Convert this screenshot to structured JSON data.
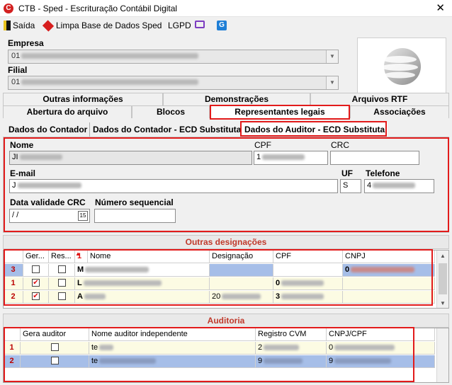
{
  "window": {
    "title": "CTB - Sped - Escrituração Contábil Digital",
    "close": "✕"
  },
  "menu": {
    "exit": "Saída",
    "clear_db": "Limpa Base de Dados Sped",
    "lgpd": "LGPD"
  },
  "header": {
    "empresa_label": "Empresa",
    "empresa_value": "01",
    "filial_label": "Filial",
    "filial_value": "01"
  },
  "tabs_row1": [
    "Outras informações",
    "Demonstrações",
    "Arquivos RTF"
  ],
  "tabs_row2": [
    "Abertura do arquivo",
    "Blocos",
    "Representantes legais",
    "Associações"
  ],
  "subtabs": [
    "Dados do Contador",
    "Dados do Contador - ECD Substituta",
    "Dados do Auditor - ECD Substituta"
  ],
  "form": {
    "nome_label": "Nome",
    "nome_value": "JI",
    "cpf_label": "CPF",
    "cpf_value": "1",
    "crc_label": "CRC",
    "crc_value": "",
    "email_label": "E-mail",
    "email_value": "J",
    "uf_label": "UF",
    "uf_value": "S",
    "telefone_label": "Telefone",
    "telefone_value": "4",
    "validade_label": "Data validade CRC",
    "validade_value": " / /",
    "validade_btn": "15",
    "seq_label": "Número sequencial",
    "seq_value": ""
  },
  "designacoes": {
    "title": "Outras designações",
    "columns": [
      "Ger...",
      "Res...",
      "Nome",
      "Designação",
      "CPF",
      "CNPJ"
    ],
    "sort_indicator": "1",
    "rows": [
      {
        "num": "3",
        "gera": false,
        "res": false,
        "nome": "M",
        "designacao": "",
        "cpf": "",
        "cnpj": "0"
      },
      {
        "num": "1",
        "gera": true,
        "res": false,
        "nome": "L",
        "designacao": "",
        "cpf": "0",
        "cnpj": ""
      },
      {
        "num": "2",
        "gera": true,
        "res": false,
        "nome": "A",
        "designacao": "20",
        "cpf": "3",
        "cnpj": ""
      }
    ]
  },
  "auditoria": {
    "title": "Auditoria",
    "columns": [
      "Gera auditor",
      "Nome auditor independente",
      "Registro CVM",
      "CNPJ/CPF"
    ],
    "rows": [
      {
        "num": "1",
        "gera": false,
        "nome": "te",
        "registro": "2",
        "cnpj": "0"
      },
      {
        "num": "2",
        "gera": false,
        "nome": "te",
        "registro": "9",
        "cnpj": "9"
      }
    ]
  },
  "colors": {
    "highlight": "#a6bee8",
    "stripe": "#fcfbe3",
    "accent_red": "#e21b1b"
  }
}
